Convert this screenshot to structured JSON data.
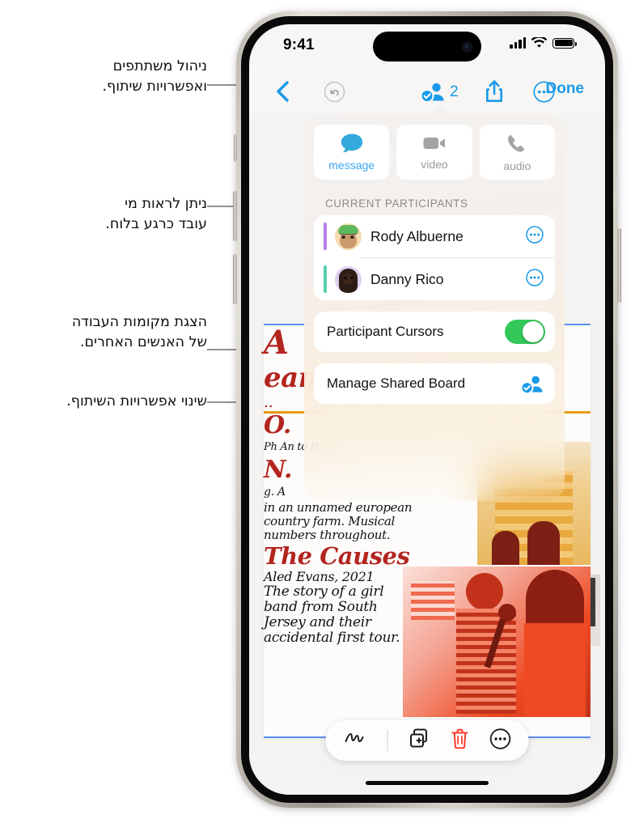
{
  "callouts": [
    {
      "id": "manage-participants",
      "text": "ניהול משתתפים\nואפשרויות שיתוף."
    },
    {
      "id": "see-who-working",
      "text": "ניתן לראות מי\nעובד כרגע בלוח."
    },
    {
      "id": "show-others-work",
      "text": "הצגת מקומות העבודה\nשל האנשים האחרים."
    },
    {
      "id": "change-share-options",
      "text": "שינוי אפשרויות השיתוף."
    }
  ],
  "status_bar": {
    "time": "9:41",
    "cellular_icon": "signal-bars-icon",
    "wifi_icon": "wifi-icon",
    "battery_icon": "battery-full-icon"
  },
  "nav_bar": {
    "back_icon": "chevron-left-icon",
    "undo_icon": "undo-icon",
    "participants_icon": "shared-with-you-person-icon",
    "participants_count": "2",
    "share_icon": "share-square-up-arrow-icon",
    "more_icon": "ellipsis-circle-icon",
    "done_label": "Done"
  },
  "popover": {
    "actions": [
      {
        "label": "message",
        "icon": "message-bubble-icon",
        "state": "active"
      },
      {
        "label": "video",
        "icon": "video-camera-icon",
        "state": "dimmed"
      },
      {
        "label": "audio",
        "icon": "phone-handset-icon",
        "state": "dimmed"
      }
    ],
    "section_header": "CURRENT PARTICIPANTS",
    "participants": [
      {
        "name": "Rody Albuerne",
        "cursor_color": "#b07ee8",
        "avatar": "memoji-rody",
        "more_icon": "ellipsis-circle-icon"
      },
      {
        "name": "Danny Rico",
        "cursor_color": "#57cfae",
        "avatar": "memoji-danny",
        "more_icon": "ellipsis-circle-icon"
      }
    ],
    "participant_cursors": {
      "label": "Participant Cursors",
      "enabled": true,
      "on_color": "#34c759"
    },
    "manage_shared_board": {
      "label": "Manage Shared Board",
      "icon": "shared-with-you-person-icon"
    }
  },
  "board": {
    "handwriting": [
      {
        "id": "title-a",
        "text": "A",
        "color": "#b3251f"
      },
      {
        "id": "title-eam",
        "text": "eam",
        "color": "#b3251f"
      },
      {
        "id": "note-o",
        "text": "O.",
        "color": "#b3251f"
      },
      {
        "id": "note-o-lines",
        "text": "Ph\nAn\nto\nIt\nfu",
        "color": "#111111"
      },
      {
        "id": "title-n",
        "text": "N.",
        "color": "#b3251f"
      },
      {
        "id": "note-n-lines",
        "text": "g.\nA",
        "color": "#111111"
      },
      {
        "id": "synopsis-1",
        "text": "in an unnamed\neuropean country\nfarm. Musical\nnumbers throughout.",
        "color": "#111111"
      },
      {
        "id": "causes-title",
        "text": "The Causes",
        "color": "#b3251f"
      },
      {
        "id": "causes-credit",
        "text": "Aled Evans, 2021",
        "color": "#111111"
      },
      {
        "id": "causes-body",
        "text": "The story of a\ngirl band from\nSouth Jersey and\ntheir accidental\nfirst tour.",
        "color": "#111111"
      }
    ],
    "images": [
      {
        "id": "photo-gray-interior",
        "alt": "black-and-white-photo"
      },
      {
        "id": "photo-city-building",
        "alt": "orange-city-illustration"
      },
      {
        "id": "photo-band",
        "alt": "red-band-illustration"
      }
    ]
  },
  "toolbar": {
    "items": [
      {
        "icon": "scribble-pen-icon",
        "name": "markup-tool"
      },
      {
        "icon": "add-page-icon",
        "name": "add-page"
      },
      {
        "icon": "trash-icon",
        "name": "delete",
        "color": "#ff3b30"
      },
      {
        "icon": "ellipsis-circle-icon",
        "name": "more-options"
      }
    ]
  },
  "home_indicator": "home-indicator"
}
